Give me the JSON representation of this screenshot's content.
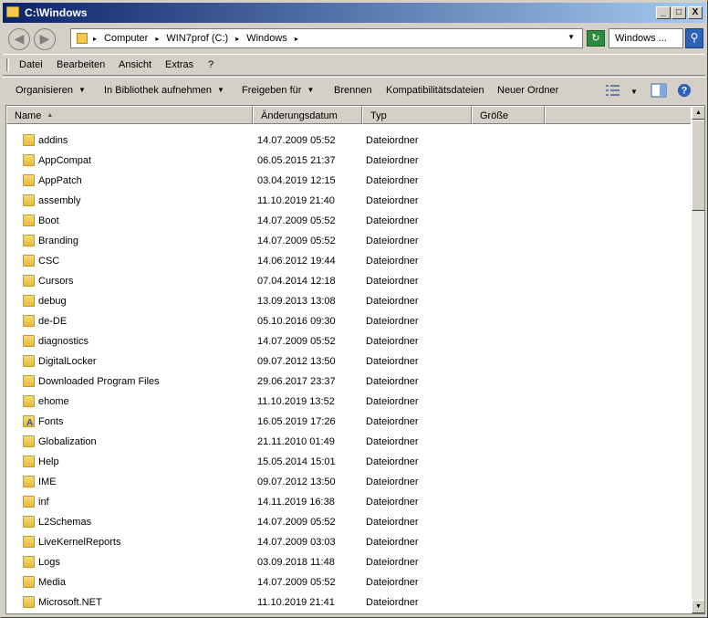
{
  "window": {
    "title": "C:\\Windows"
  },
  "caption_buttons": {
    "minimize": "_",
    "maximize": "□",
    "close": "X"
  },
  "address": {
    "crumbs": [
      "Computer",
      "WIN7prof (C:)",
      "Windows"
    ],
    "search_value": "Windows ..."
  },
  "menu": {
    "items": [
      "Datei",
      "Bearbeiten",
      "Ansicht",
      "Extras",
      "?"
    ]
  },
  "toolbar": {
    "organize": "Organisieren",
    "library": "In Bibliothek aufnehmen",
    "share": "Freigeben für",
    "burn": "Brennen",
    "compat": "Kompatibilitätsdateien",
    "new_folder": "Neuer Ordner"
  },
  "columns": {
    "name": "Name",
    "date": "Änderungsdatum",
    "type": "Typ",
    "size": "Größe"
  },
  "rows": [
    {
      "name": "addins",
      "date": "14.07.2009 05:52",
      "type": "Dateiordner"
    },
    {
      "name": "AppCompat",
      "date": "06.05.2015 21:37",
      "type": "Dateiordner"
    },
    {
      "name": "AppPatch",
      "date": "03.04.2019 12:15",
      "type": "Dateiordner"
    },
    {
      "name": "assembly",
      "date": "11.10.2019 21:40",
      "type": "Dateiordner"
    },
    {
      "name": "Boot",
      "date": "14.07.2009 05:52",
      "type": "Dateiordner"
    },
    {
      "name": "Branding",
      "date": "14.07.2009 05:52",
      "type": "Dateiordner"
    },
    {
      "name": "CSC",
      "date": "14.06.2012 19:44",
      "type": "Dateiordner"
    },
    {
      "name": "Cursors",
      "date": "07.04.2014 12:18",
      "type": "Dateiordner"
    },
    {
      "name": "debug",
      "date": "13.09.2013 13:08",
      "type": "Dateiordner"
    },
    {
      "name": "de-DE",
      "date": "05.10.2016 09:30",
      "type": "Dateiordner"
    },
    {
      "name": "diagnostics",
      "date": "14.07.2009 05:52",
      "type": "Dateiordner"
    },
    {
      "name": "DigitalLocker",
      "date": "09.07.2012 13:50",
      "type": "Dateiordner"
    },
    {
      "name": "Downloaded Program Files",
      "date": "29.06.2017 23:37",
      "type": "Dateiordner"
    },
    {
      "name": "ehome",
      "date": "11.10.2019 13:52",
      "type": "Dateiordner"
    },
    {
      "name": "Fonts",
      "date": "16.05.2019 17:26",
      "type": "Dateiordner"
    },
    {
      "name": "Globalization",
      "date": "21.11.2010 01:49",
      "type": "Dateiordner"
    },
    {
      "name": "Help",
      "date": "15.05.2014 15:01",
      "type": "Dateiordner"
    },
    {
      "name": "IME",
      "date": "09.07.2012 13:50",
      "type": "Dateiordner"
    },
    {
      "name": "inf",
      "date": "14.11.2019 16:38",
      "type": "Dateiordner"
    },
    {
      "name": "L2Schemas",
      "date": "14.07.2009 05:52",
      "type": "Dateiordner"
    },
    {
      "name": "LiveKernelReports",
      "date": "14.07.2009 03:03",
      "type": "Dateiordner"
    },
    {
      "name": "Logs",
      "date": "03.09.2018 11:48",
      "type": "Dateiordner"
    },
    {
      "name": "Media",
      "date": "14.07.2009 05:52",
      "type": "Dateiordner"
    },
    {
      "name": "Microsoft.NET",
      "date": "11.10.2019 21:41",
      "type": "Dateiordner"
    }
  ]
}
